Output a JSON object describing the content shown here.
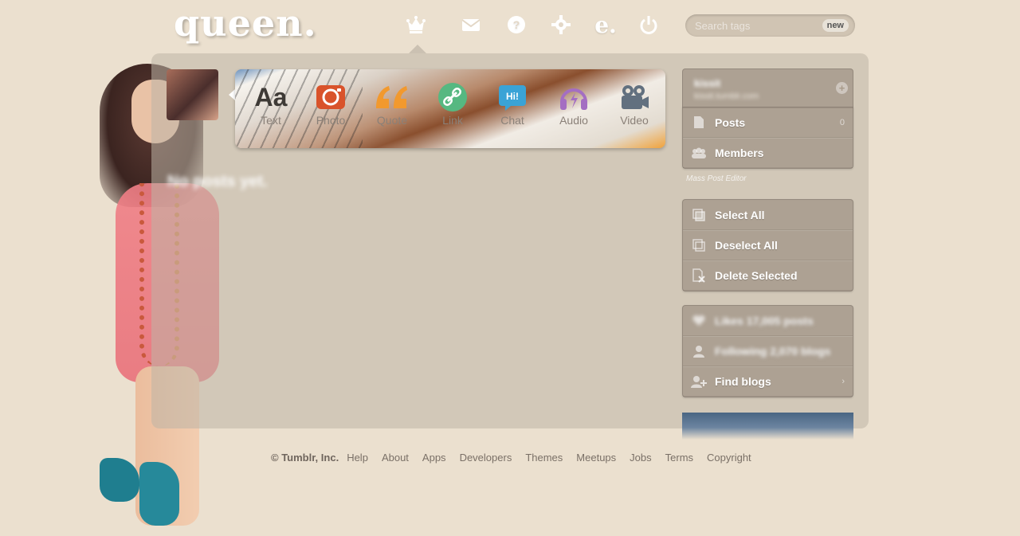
{
  "header": {
    "logo": "queen.",
    "nav": [
      {
        "name": "dashboard",
        "icon": "crown-icon"
      },
      {
        "name": "messages",
        "icon": "mail-icon"
      },
      {
        "name": "help",
        "icon": "help-icon"
      },
      {
        "name": "settings",
        "icon": "gear-icon"
      },
      {
        "name": "explore",
        "icon": "explore-e-icon"
      },
      {
        "name": "logout",
        "icon": "power-icon"
      }
    ],
    "search": {
      "placeholder": "Search tags",
      "badge": "new"
    }
  },
  "post_types": [
    {
      "label": "Text",
      "icon": "text-aa-icon",
      "color": "#3e3a36"
    },
    {
      "label": "Photo",
      "icon": "camera-icon",
      "color": "#d9532b"
    },
    {
      "label": "Quote",
      "icon": "quote-icon",
      "color": "#f2992e"
    },
    {
      "label": "Link",
      "icon": "link-icon",
      "color": "#56b881"
    },
    {
      "label": "Chat",
      "icon": "chat-icon",
      "color": "#3aa3d6"
    },
    {
      "label": "Audio",
      "icon": "headphones-icon",
      "color": "#a46ec2"
    },
    {
      "label": "Video",
      "icon": "video-camera-icon",
      "color": "#62707f"
    }
  ],
  "main": {
    "empty_text": "No posts yet."
  },
  "sidebar": {
    "blog": {
      "name": "kissit",
      "url": "kissit.tumblr.com"
    },
    "primary": [
      {
        "label": "Posts",
        "icon": "document-icon",
        "count": "0"
      },
      {
        "label": "Members",
        "icon": "members-icon",
        "count": ""
      }
    ],
    "mass_post_editor": "Mass Post Editor",
    "actions": [
      {
        "label": "Select All",
        "icon": "select-all-icon"
      },
      {
        "label": "Deselect All",
        "icon": "deselect-all-icon"
      },
      {
        "label": "Delete Selected",
        "icon": "delete-selected-icon"
      }
    ],
    "account": [
      {
        "label": "Likes 17,005 posts",
        "icon": "heart-icon",
        "blurred": true
      },
      {
        "label": "Following 2,070 blogs",
        "icon": "person-icon",
        "blurred": true
      },
      {
        "label": "Find blogs",
        "icon": "add-person-icon",
        "blurred": false
      }
    ]
  },
  "footer": {
    "copyright": "© Tumblr, Inc.",
    "links": [
      "Help",
      "About",
      "Apps",
      "Developers",
      "Themes",
      "Meetups",
      "Jobs",
      "Terms",
      "Copyright"
    ]
  }
}
